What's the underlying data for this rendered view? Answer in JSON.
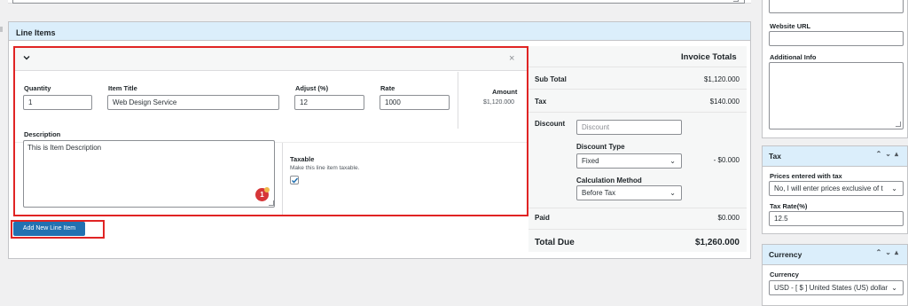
{
  "line_items": {
    "header": "Line Items",
    "item": {
      "quantity_label": "Quantity",
      "quantity_value": "1",
      "title_label": "Item Title",
      "title_value": "Web Design Service",
      "adjust_label": "Adjust (%)",
      "adjust_value": "12",
      "rate_label": "Rate",
      "rate_value": "1000",
      "amount_label": "Amount",
      "amount_value": "$1,120.000",
      "description_label": "Description",
      "description_value": "This is Item Description",
      "taxable_label": "Taxable",
      "taxable_help": "Make this line item taxable.",
      "taxable_checked": true,
      "badge_count": "1",
      "close_symbol": "×"
    },
    "add_button": "Add New Line Item"
  },
  "totals": {
    "header": "Invoice Totals",
    "subtotal_label": "Sub Total",
    "subtotal_value": "$1,120.000",
    "tax_label": "Tax",
    "tax_value": "$140.000",
    "discount_label": "Discount",
    "discount_placeholder": "Discount",
    "discount_type_label": "Discount Type",
    "discount_type_value": "Fixed",
    "calc_method_label": "Calculation Method",
    "calc_method_value": "Before Tax",
    "discount_value": "- $0.000",
    "paid_label": "Paid",
    "paid_value": "$0.000",
    "total_due_label": "Total Due",
    "total_due_value": "$1,260.000"
  },
  "sidebar": {
    "website_url_label": "Website URL",
    "additional_info_label": "Additional Info",
    "tax": {
      "header": "Tax",
      "prices_label": "Prices entered with tax",
      "prices_value": "No, I will enter prices exclusive of t",
      "rate_label": "Tax Rate(%)",
      "rate_value": "12.5"
    },
    "currency": {
      "header": "Currency",
      "label": "Currency",
      "value": "USD - [ $ ] United States (US) dollar"
    }
  },
  "colors": {
    "accent": "#2271b1",
    "header_bg": "#dbeefb",
    "highlight": "#e02424"
  },
  "icons": {
    "collapse": "chevron-down-icon",
    "close": "close-icon",
    "select_arrow": "chevron-down-icon",
    "panel_controls": "arrow-up-down-toggle-icons"
  }
}
